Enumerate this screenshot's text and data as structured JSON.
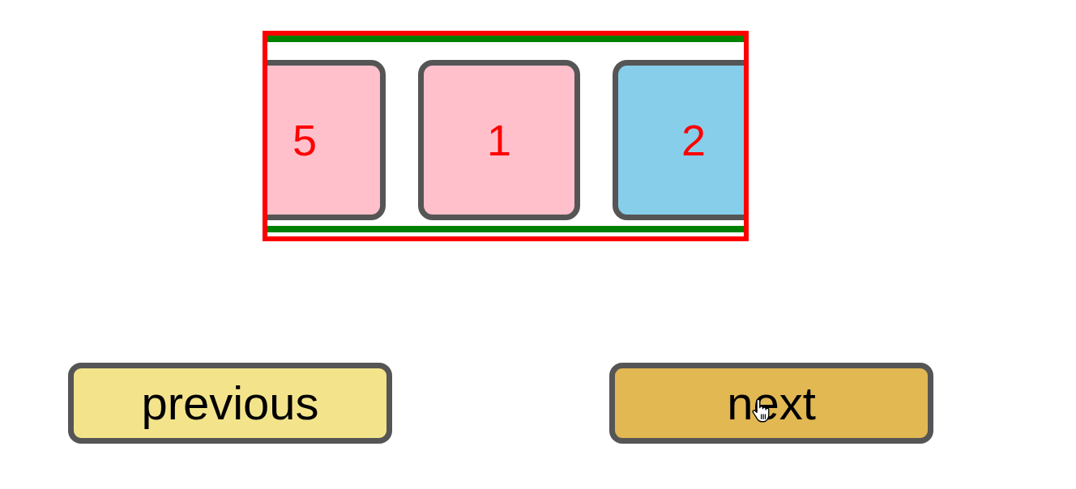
{
  "carousel": {
    "cards": [
      {
        "label": "5",
        "color": "#ffc0cb"
      },
      {
        "label": "1",
        "color": "#ffc0cb"
      },
      {
        "label": "2",
        "color": "#87ceeb"
      }
    ]
  },
  "buttons": [
    {
      "label": "previous",
      "hovered": false
    },
    {
      "label": "next",
      "hovered": true
    }
  ]
}
